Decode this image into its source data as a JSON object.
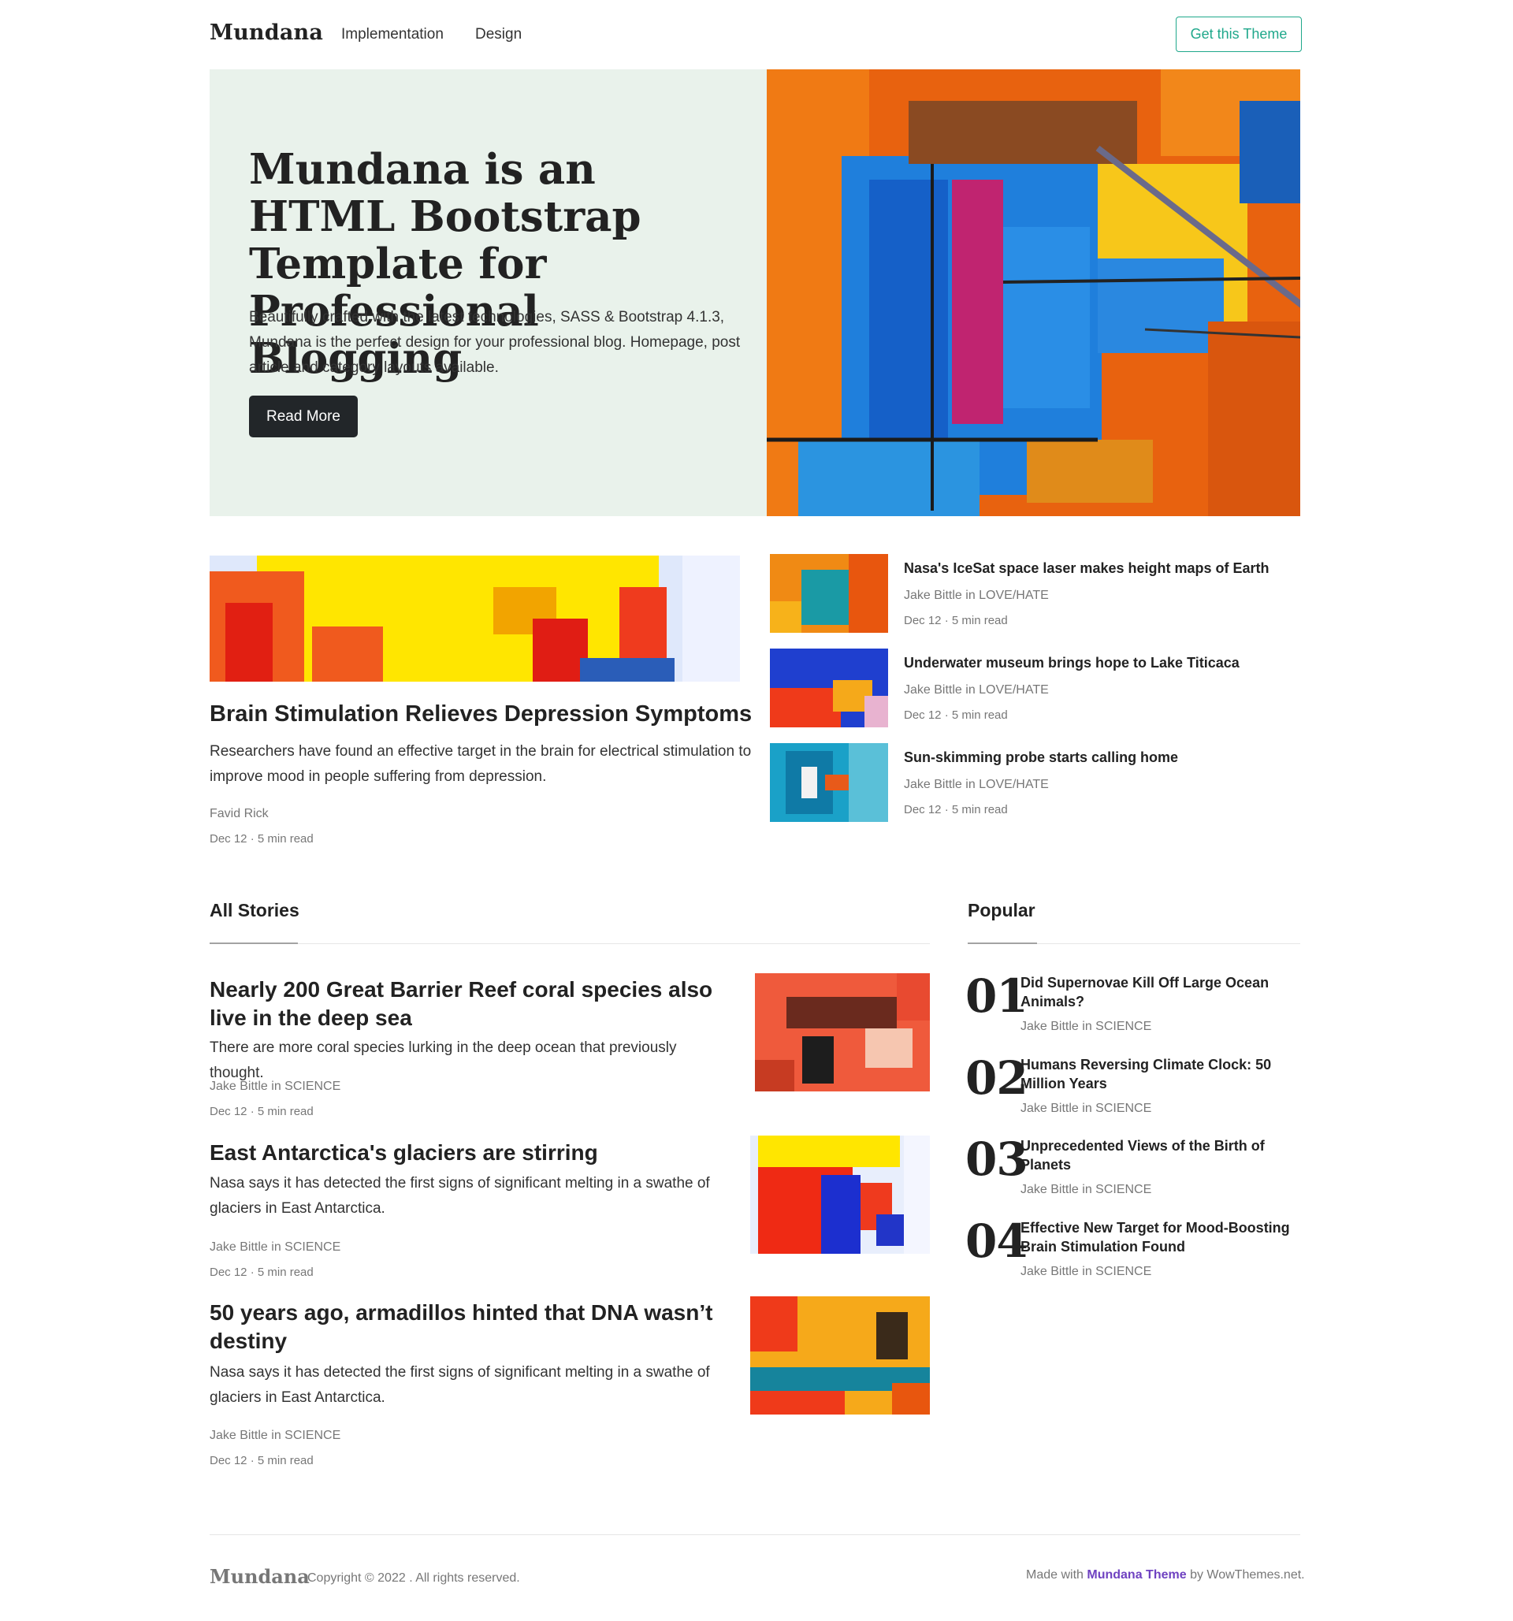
{
  "nav": {
    "brand": "Mundana",
    "links": [
      "Implementation",
      "Design"
    ],
    "cta": "Get this Theme"
  },
  "hero": {
    "title": "Mundana is an HTML Bootstrap Template for Professional Blogging",
    "text": "Beautifully crafted with the latest technologies, SASS & Bootstrap 4.1.3, Mundana is the perfect design for your professional blog. Homepage, post article and category layouts available.",
    "button": "Read More"
  },
  "featured": {
    "title": "Brain Stimulation Relieves Depression Symptoms",
    "text": "Researchers have found an effective target in the brain for electrical stimulation to improve mood in people suffering from depression.",
    "author": "Favid Rick",
    "date": "Dec 12 · 5 min read"
  },
  "side": [
    {
      "title": "Nasa's IceSat space laser makes height maps of Earth",
      "author": "Jake Bittle in LOVE/HATE",
      "date": "Dec 12 · 5 min read"
    },
    {
      "title": "Underwater museum brings hope to Lake Titicaca",
      "author": "Jake Bittle in LOVE/HATE",
      "date": "Dec 12 · 5 min read"
    },
    {
      "title": "Sun-skimming probe starts calling home",
      "author": "Jake Bittle in LOVE/HATE",
      "date": "Dec 12 · 5 min read"
    }
  ],
  "all_stories": {
    "heading": "All Stories",
    "items": [
      {
        "title": "Nearly 200 Great Barrier Reef coral species also live in the deep sea",
        "text": "There are more coral species lurking in the deep ocean that previously thought.",
        "author": "Jake Bittle in SCIENCE",
        "date": "Dec 12 · 5 min read"
      },
      {
        "title": "East Antarctica's glaciers are stirring",
        "text": "Nasa says it has detected the first signs of significant melting in a swathe of glaciers in East Antarctica.",
        "author": "Jake Bittle in SCIENCE",
        "date": "Dec 12 · 5 min read"
      },
      {
        "title": "50 years ago, armadillos hinted that DNA wasn’t destiny",
        "text": "Nasa says it has detected the first signs of significant melting in a swathe of glaciers in East Antarctica.",
        "author": "Jake Bittle in SCIENCE",
        "date": "Dec 12 · 5 min read"
      }
    ]
  },
  "popular": {
    "heading": "Popular",
    "items": [
      {
        "num": "01",
        "title": "Did Supernovae Kill Off Large Ocean Animals?",
        "author": "Jake Bittle in SCIENCE"
      },
      {
        "num": "02",
        "title": "Humans Reversing Climate Clock: 50 Million Years",
        "author": "Jake Bittle in SCIENCE"
      },
      {
        "num": "03",
        "title": "Unprecedented Views of the Birth of Planets",
        "author": "Jake Bittle in SCIENCE"
      },
      {
        "num": "04",
        "title": "Effective New Target for Mood-Boosting Brain Stimulation Found",
        "author": "Jake Bittle in SCIENCE"
      }
    ]
  },
  "footer": {
    "brand": "Mundana",
    "copyright": "Copyright © 2022 . All rights reserved.",
    "made_prefix": "Made with",
    "theme_link": "Mundana Theme",
    "made_suffix": "by WowThemes.net."
  },
  "colors": {
    "hero_bg": "#e9f2eb",
    "cta_accent": "#1fa88b",
    "button_dark": "#222629",
    "footer_link": "#6f42c1"
  }
}
